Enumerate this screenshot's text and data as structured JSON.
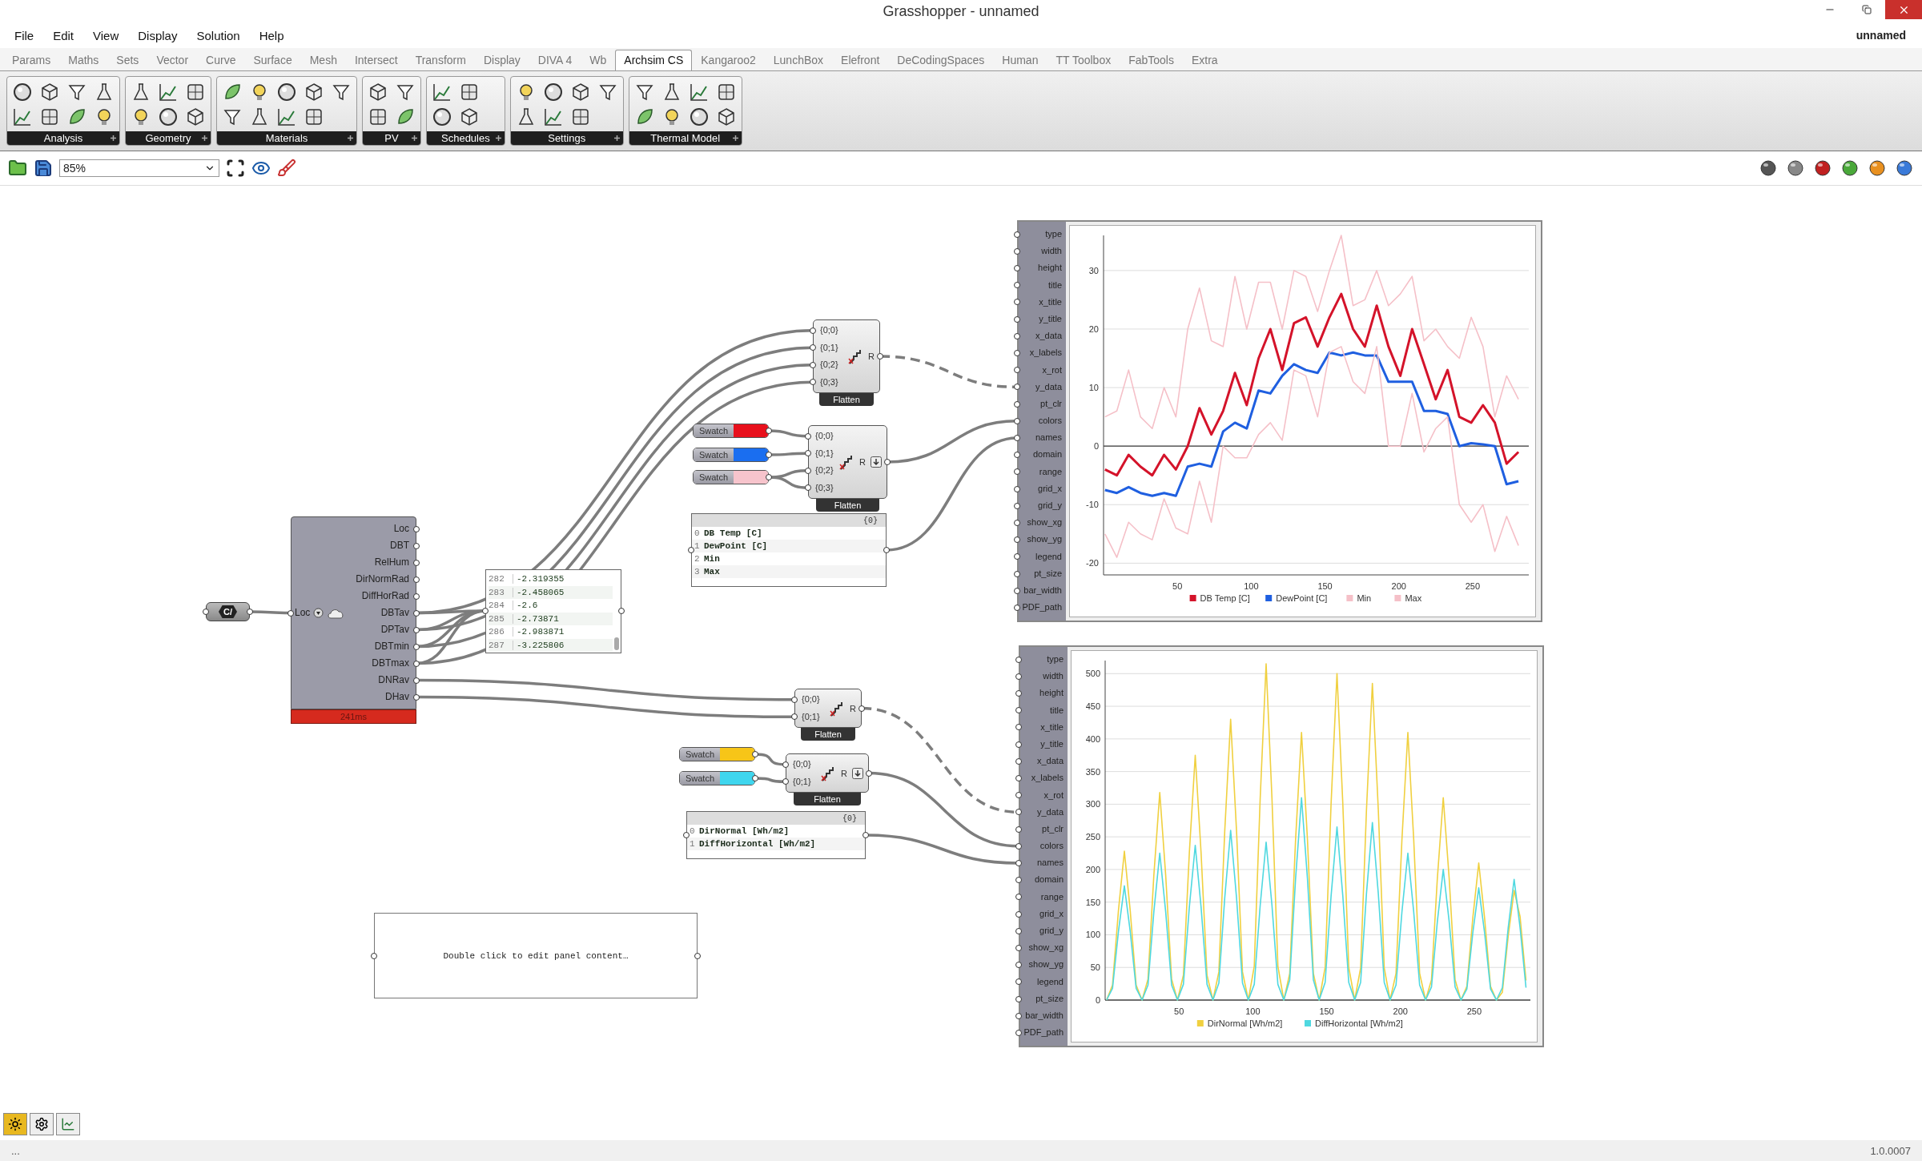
{
  "window": {
    "title": "Grasshopper - unnamed",
    "document": "unnamed"
  },
  "menu": [
    "File",
    "Edit",
    "View",
    "Display",
    "Solution",
    "Help"
  ],
  "tabs": [
    {
      "label": "Params",
      "selected": false
    },
    {
      "label": "Maths",
      "selected": false
    },
    {
      "label": "Sets",
      "selected": false
    },
    {
      "label": "Vector",
      "selected": false
    },
    {
      "label": "Curve",
      "selected": false
    },
    {
      "label": "Surface",
      "selected": false
    },
    {
      "label": "Mesh",
      "selected": false
    },
    {
      "label": "Intersect",
      "selected": false
    },
    {
      "label": "Transform",
      "selected": false
    },
    {
      "label": "Display",
      "selected": false
    },
    {
      "label": "DIVA 4",
      "selected": false
    },
    {
      "label": "Wb",
      "selected": false
    },
    {
      "label": "Archsim CS",
      "selected": true
    },
    {
      "label": "Kangaroo2",
      "selected": false
    },
    {
      "label": "LunchBox",
      "selected": false
    },
    {
      "label": "Elefront",
      "selected": false
    },
    {
      "label": "DeCodingSpaces",
      "selected": false
    },
    {
      "label": "Human",
      "selected": false
    },
    {
      "label": "TT Toolbox",
      "selected": false
    },
    {
      "label": "FabTools",
      "selected": false
    },
    {
      "label": "Extra",
      "selected": false
    }
  ],
  "ribbon_groups": [
    {
      "label": "Analysis"
    },
    {
      "label": "Geometry"
    },
    {
      "label": "Materials"
    },
    {
      "label": "PV"
    },
    {
      "label": "Schedules"
    },
    {
      "label": "Settings"
    },
    {
      "label": "Thermal Model"
    }
  ],
  "canvas_toolbar": {
    "zoom": "85%"
  },
  "canvas": {
    "location_param": {
      "label": "C/"
    },
    "weather_component": {
      "input": "Loc",
      "outputs": [
        "Loc",
        "DBT",
        "RelHum",
        "DirNormRad",
        "DiffHorRad",
        "DBTav",
        "DPTav",
        "DBTmin",
        "DBTmax",
        "DNRav",
        "DHav"
      ],
      "timing": "241ms"
    },
    "data_panel": {
      "rows": [
        {
          "index": "282",
          "value": "-2.319355"
        },
        {
          "index": "283",
          "value": "-2.458065"
        },
        {
          "index": "284",
          "value": "-2.6"
        },
        {
          "index": "285",
          "value": "-2.73871"
        },
        {
          "index": "286",
          "value": "-2.983871"
        },
        {
          "index": "287",
          "value": "-3.225806"
        }
      ]
    },
    "merges": [
      {
        "inputs": [
          "{0;0}",
          "{0;1}",
          "{0;2}",
          "{0;3}"
        ],
        "output": "R",
        "label": "Flatten",
        "flatten_mark": false
      },
      {
        "inputs": [
          "{0;0}",
          "{0;1}",
          "{0;2}",
          "{0;3}"
        ],
        "output": "R",
        "label": "Flatten",
        "flatten_mark": true
      },
      {
        "inputs": [
          "{0;0}",
          "{0;1}"
        ],
        "output": "R",
        "label": "Flatten",
        "flatten_mark": false
      },
      {
        "inputs": [
          "{0;0}",
          "{0;1}"
        ],
        "output": "R",
        "label": "Flatten",
        "flatten_mark": true
      }
    ],
    "swatches": [
      {
        "label": "Swatch",
        "color": "#e8101c"
      },
      {
        "label": "Swatch",
        "color": "#1a6ef0"
      },
      {
        "label": "Swatch",
        "color": "#f7c4cc"
      },
      {
        "label": "Swatch",
        "color": "#f7c518"
      },
      {
        "label": "Swatch",
        "color": "#3fd6ee"
      }
    ],
    "list_panels": [
      {
        "path": "{0}",
        "lines": [
          {
            "index": "0",
            "text": "DB Temp [C]"
          },
          {
            "index": "1",
            "text": "DewPoint [C]"
          },
          {
            "index": "2",
            "text": "Min"
          },
          {
            "index": "3",
            "text": "Max"
          }
        ]
      },
      {
        "path": "{0}",
        "lines": [
          {
            "index": "0",
            "text": "DirNormal [Wh/m2]"
          },
          {
            "index": "1",
            "text": "DiffHorizontal [Wh/m2]"
          }
        ]
      }
    ],
    "note_panel": {
      "text": "Double click to edit panel content…"
    },
    "charts": [
      {
        "inputs": [
          "type",
          "width",
          "height",
          "title",
          "x_title",
          "y_title",
          "x_data",
          "x_labels",
          "x_rot",
          "y_data",
          "pt_clr",
          "colors",
          "names",
          "domain",
          "range",
          "grid_x",
          "grid_y",
          "show_xg",
          "show_yg",
          "legend",
          "pt_size",
          "bar_width",
          "PDF_path"
        ],
        "chart_data": {
          "type": "line",
          "grid": true,
          "legend": "bottom",
          "xlim": [
            0,
            288
          ],
          "ylim": [
            -22,
            36
          ],
          "xticks": [
            50,
            100,
            150,
            200,
            250
          ],
          "yticks": [
            -20,
            -10,
            0,
            10,
            20,
            30
          ],
          "x": [
            1,
            9,
            17,
            25,
            33,
            41,
            49,
            57,
            65,
            73,
            81,
            89,
            97,
            105,
            113,
            121,
            129,
            137,
            145,
            153,
            161,
            169,
            177,
            185,
            193,
            201,
            209,
            217,
            225,
            233,
            241,
            249,
            257,
            265,
            273,
            281
          ],
          "series": [
            {
              "name": "DB Temp [C]",
              "color": "#d4132a",
              "values": [
                -4,
                -5,
                -1.5,
                -3.5,
                -5,
                -1.5,
                -4,
                0,
                6.5,
                2,
                6,
                12.5,
                7,
                15,
                20,
                13,
                21,
                22,
                17,
                22,
                26,
                20,
                17,
                24,
                17,
                12,
                20,
                14,
                8,
                13,
                5,
                4,
                7,
                4,
                -3,
                -1
              ]
            },
            {
              "name": "DewPoint [C]",
              "color": "#1f5fe0",
              "values": [
                -7.5,
                -8,
                -7,
                -8,
                -8.5,
                -8,
                -8.5,
                -3.5,
                -3,
                -3.5,
                2.5,
                4,
                3,
                9.5,
                9,
                12,
                14,
                13,
                12.5,
                16,
                15.5,
                16,
                15.5,
                15.5,
                11,
                11,
                11,
                6,
                6,
                5.5,
                0,
                0.5,
                0.3,
                0,
                -6.5,
                -6
              ]
            },
            {
              "name": "Min",
              "color": "#f5c0c8",
              "values": [
                -15,
                -19,
                -13,
                -15,
                -16,
                -9,
                -14,
                -15,
                -6,
                -13,
                0,
                -2,
                -2,
                2,
                4,
                1,
                13,
                12,
                5,
                16,
                17,
                11,
                9,
                17,
                0,
                0,
                9,
                -1,
                3,
                5,
                -10,
                -13,
                -10,
                -18,
                -12,
                -17
              ]
            },
            {
              "name": "Max",
              "color": "#f5c0c8",
              "values": [
                5,
                6,
                13,
                5,
                3,
                10,
                5,
                20,
                27,
                18,
                17,
                29,
                20,
                28,
                28,
                20,
                30,
                29,
                23,
                30,
                36,
                24,
                25,
                30,
                24,
                26,
                29,
                18,
                20,
                17,
                15,
                22,
                17,
                5,
                12,
                8
              ]
            }
          ]
        }
      },
      {
        "inputs": [
          "type",
          "width",
          "height",
          "title",
          "x_title",
          "y_title",
          "x_data",
          "x_labels",
          "x_rot",
          "y_data",
          "pt_clr",
          "colors",
          "names",
          "domain",
          "range",
          "grid_x",
          "grid_y",
          "show_xg",
          "show_yg",
          "legend",
          "pt_size",
          "bar_width",
          "PDF_path"
        ],
        "chart_data": {
          "type": "line",
          "grid": true,
          "legend": "bottom",
          "xlim": [
            0,
            288
          ],
          "ylim": [
            0,
            520
          ],
          "xticks": [
            50,
            100,
            150,
            200,
            250
          ],
          "yticks": [
            0,
            50,
            100,
            150,
            200,
            250,
            300,
            350,
            400,
            450,
            500
          ],
          "x": [
            1,
            5,
            9,
            13,
            17,
            21,
            25,
            29,
            33,
            37,
            41,
            45,
            49,
            53,
            57,
            61,
            65,
            69,
            73,
            77,
            81,
            85,
            89,
            93,
            97,
            101,
            105,
            109,
            113,
            117,
            121,
            125,
            129,
            133,
            137,
            141,
            145,
            149,
            153,
            157,
            161,
            165,
            169,
            173,
            177,
            181,
            185,
            189,
            193,
            197,
            201,
            205,
            209,
            213,
            217,
            221,
            225,
            229,
            233,
            237,
            241,
            245,
            249,
            253,
            257,
            261,
            265,
            269,
            273,
            277,
            281,
            285
          ],
          "series": [
            {
              "name": "DirNormal [Wh/m2]",
              "color": "#f0d040",
              "values": [
                0,
                23,
                137,
                228,
                137,
                23,
                0,
                32,
                191,
                318,
                191,
                32,
                0,
                38,
                225,
                375,
                225,
                38,
                0,
                43,
                258,
                430,
                258,
                43,
                0,
                52,
                309,
                515,
                309,
                52,
                0,
                41,
                246,
                410,
                246,
                41,
                0,
                50,
                300,
                500,
                300,
                50,
                0,
                49,
                291,
                485,
                291,
                49,
                0,
                41,
                246,
                410,
                246,
                41,
                0,
                31,
                186,
                310,
                186,
                31,
                0,
                21,
                126,
                210,
                126,
                21,
                0,
                12,
                98,
                168,
                128,
                30
              ]
            },
            {
              "name": "DiffHorizontal [Wh/m2]",
              "color": "#4fd8e0",
              "values": [
                0,
                18,
                105,
                175,
                105,
                18,
                0,
                23,
                135,
                225,
                135,
                23,
                0,
                24,
                142,
                237,
                142,
                24,
                0,
                26,
                156,
                260,
                156,
                26,
                0,
                24,
                145,
                242,
                145,
                24,
                0,
                31,
                186,
                310,
                186,
                31,
                0,
                27,
                159,
                265,
                159,
                27,
                0,
                27,
                163,
                272,
                163,
                27,
                0,
                23,
                135,
                225,
                135,
                23,
                0,
                20,
                120,
                200,
                120,
                20,
                0,
                17,
                103,
                172,
                103,
                17,
                0,
                19,
                111,
                185,
                111,
                19
              ]
            }
          ]
        }
      }
    ]
  },
  "status_bar": {
    "left": "...",
    "version": "1.0.0007"
  }
}
